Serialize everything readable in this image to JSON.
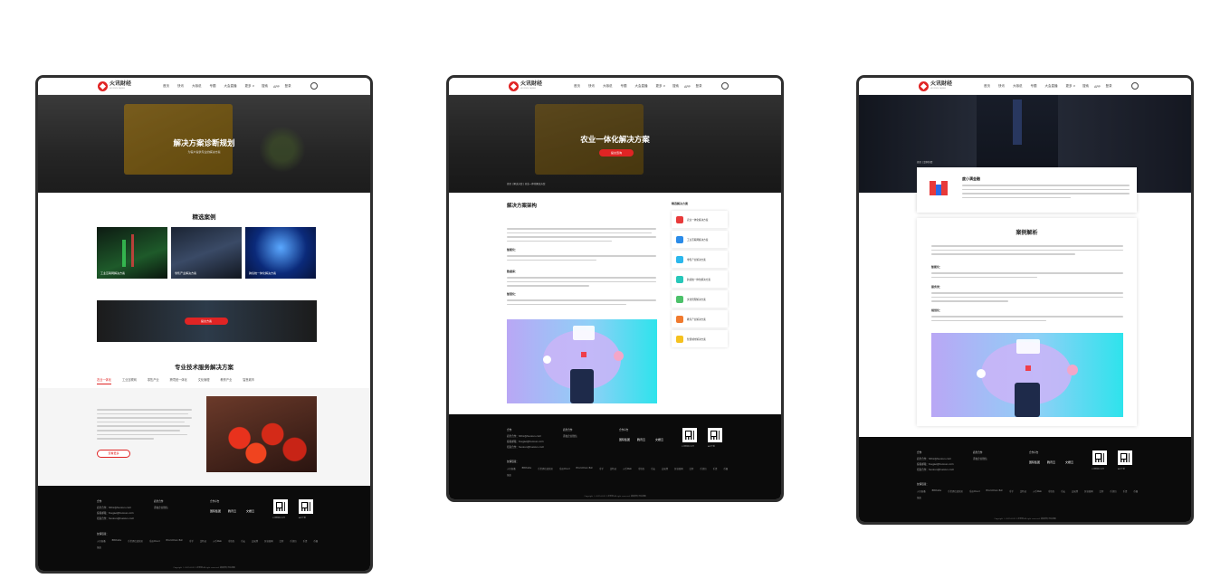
{
  "brand": {
    "name": "火讯财经",
    "tagline": "HUOXUN CAIJING"
  },
  "nav": {
    "items": [
      "首页",
      "快讯",
      "大咖说",
      "专题",
      "大会直播",
      "更多 ∨"
    ],
    "search": "搜索",
    "app": "APP",
    "login": "登录"
  },
  "p1": {
    "hero_title": "解决方案诊断规划",
    "hero_sub": "为客户提供专业的解决方案",
    "featured_title": "精选案例",
    "cases": [
      "工业互联网解决方案",
      "零售产业解决方案",
      "跨境统一体化解决方案"
    ],
    "banner_btn": "提交方案",
    "services_title": "专业技术服务解决方案",
    "tabs": [
      "农业一体化",
      "工业互联网",
      "零售产业",
      "跨境统一体化",
      "文化管理",
      "教育产业",
      "智慧城市"
    ],
    "more_btn": "查看更多"
  },
  "p2": {
    "hero_title": "农业一体化解决方案",
    "hero_btn": "提交咨询",
    "breadcrumb": "首页 | 解决方案  | 农业一体化解决方案",
    "arch_title": "解决方案架构",
    "subheads": [
      "智能化：",
      "数据库：",
      "智慧化："
    ],
    "side_title": "精选解决方案",
    "side_items": [
      "农业一体化解决方案",
      "工业互联网解决方案",
      "零售产业解决方案",
      "跨境统一体化解决方案",
      "文化管理解决方案",
      "教育产业解决方案",
      "智慧城市解决方案"
    ]
  },
  "p3": {
    "breadcrumb": "首页 | 案例详情",
    "client": "度小满金融",
    "analysis_title": "案例解析",
    "subheads": [
      "智能化：",
      "服务类：",
      "规划化："
    ]
  },
  "footer": {
    "col1_title": "合作",
    "col2_title": "商务合作",
    "col3_title": "合作平台",
    "contacts": [
      "商务合作：hhhx@huoxun.com",
      "投稿邮箱：tougao@huoxun.com",
      "招商合作：huoxun@huoxun.com"
    ],
    "wechat": "添加企业微信",
    "partners": [
      "国际集团",
      "腾讯云",
      "文娱云"
    ],
    "qr_labels": [
      "火讯财经公众号",
      "APP下载"
    ],
    "links_title": "友情链接：",
    "links": [
      "火讯直播",
      "BBCtalks",
      "币世界信息快讯",
      "币谷Cloud",
      "BlockChain Bsh",
      "币乎",
      "比特派",
      "火币Web",
      "币钱包",
      "币安",
      "交易所",
      "区块链网",
      "比特",
      "币钱包",
      "币资",
      "币圈",
      "链盒"
    ],
    "copyright": "Copyright © 2019-2021 火讯财经 All right reserved. 版权所有  网站地图"
  },
  "colors": {
    "accent": "#e02424",
    "dark": "#0b0b0b",
    "frame": "#2e2e2e"
  }
}
